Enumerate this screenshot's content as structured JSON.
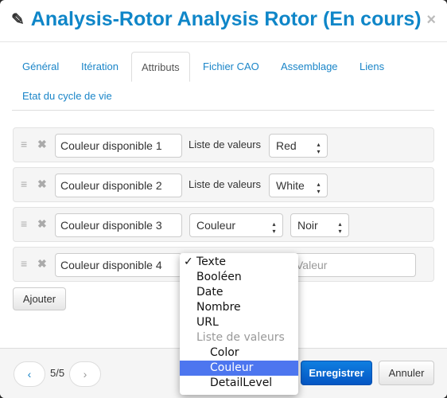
{
  "title": "Analysis-Rotor Analysis Rotor (En cours)",
  "tabs": [
    {
      "label": "Général"
    },
    {
      "label": "Itération"
    },
    {
      "label": "Attributs",
      "active": true
    },
    {
      "label": "Fichier CAO"
    },
    {
      "label": "Assemblage"
    },
    {
      "label": "Liens"
    },
    {
      "label": "Etat du cycle de vie"
    }
  ],
  "attributes": [
    {
      "name": "Couleur disponible 1",
      "type": "Liste de valeurs",
      "value": "Red"
    },
    {
      "name": "Couleur disponible 2",
      "type": "Liste de valeurs",
      "value": "White"
    },
    {
      "name": "Couleur disponible 3",
      "type": "Couleur",
      "value": "Noir"
    },
    {
      "name": "Couleur disponible 4",
      "type": "Texte",
      "value_placeholder": "Valeur"
    }
  ],
  "add_label": "Ajouter",
  "type_dropdown": {
    "selected": "Texte",
    "highlighted": "Couleur",
    "options": [
      "Texte",
      "Booléen",
      "Date",
      "Nombre",
      "URL"
    ],
    "group_label": "Liste de valeurs",
    "group_options": [
      "Color",
      "Couleur",
      "DetailLevel"
    ]
  },
  "footer": {
    "page": "5/5",
    "prev": "‹",
    "next": "›",
    "save_label": "Enregistrer",
    "cancel_label": "Annuler"
  },
  "colors": {
    "accent": "#0f86c8",
    "primary_button": "#0a6ad8",
    "highlight": "#4d76ef"
  }
}
